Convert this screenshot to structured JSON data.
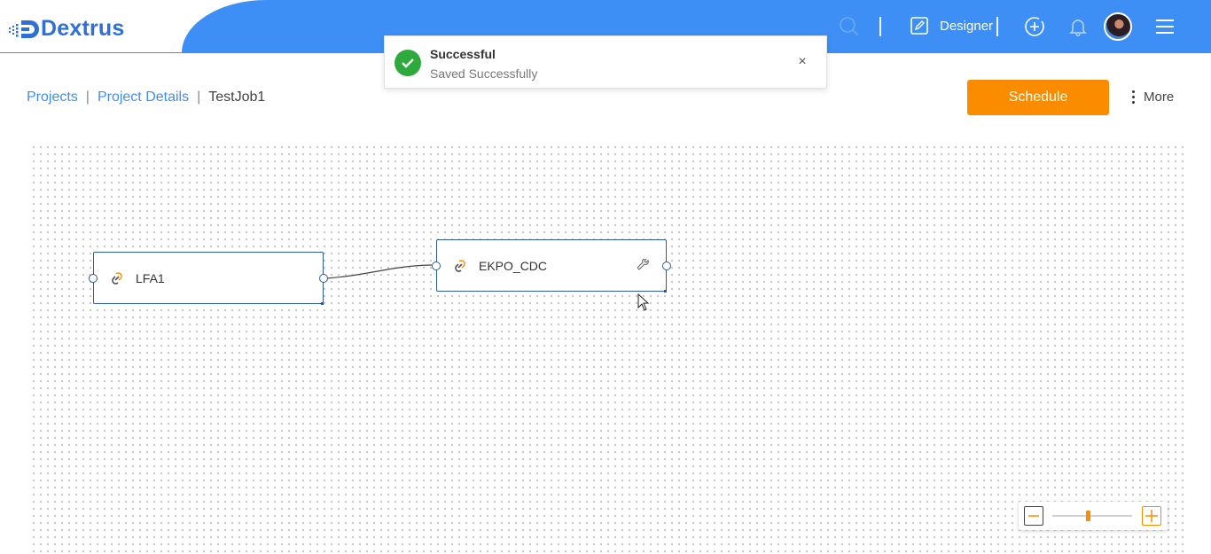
{
  "app": {
    "brand_name": "Dextrus"
  },
  "header": {
    "mode_label": "Designer",
    "icons": [
      "search-icon",
      "edit-icon",
      "add-circle-icon",
      "bell-icon",
      "avatar",
      "hamburger-menu-icon"
    ]
  },
  "toast": {
    "title": "Successful",
    "message": "Saved Successfully",
    "close_label": "×",
    "status_color": "#2eaa3c"
  },
  "breadcrumb": {
    "items": [
      {
        "label": "Projects"
      },
      {
        "label": "Project Details"
      }
    ],
    "separator": "|",
    "current": "TestJob1"
  },
  "actions": {
    "schedule_label": "Schedule",
    "more_label": "More"
  },
  "canvas": {
    "nodes": [
      {
        "label": "LFA1",
        "icon": "link-icon"
      },
      {
        "label": "EKPO_CDC",
        "icon": "link-icon",
        "action_icon": "wrench-icon"
      }
    ],
    "edges": [
      {
        "from": "LFA1",
        "to": "EKPO_CDC"
      }
    ]
  },
  "zoom": {
    "level_fraction": 0.45
  },
  "colors": {
    "brand_blue": "#3d8ff5",
    "accent_orange": "#fb8c00",
    "node_border": "#2c5aa0"
  }
}
